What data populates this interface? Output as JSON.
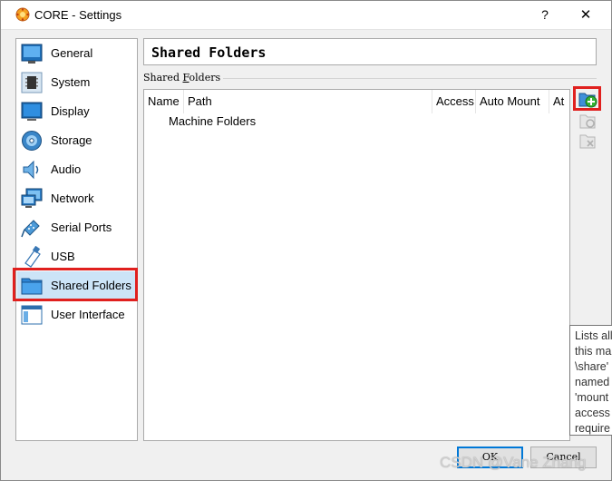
{
  "window": {
    "title": "CORE - Settings",
    "help_label": "?",
    "close_label": "✕"
  },
  "nav": {
    "items": [
      {
        "label": "General",
        "icon": "general-icon"
      },
      {
        "label": "System",
        "icon": "chip-icon"
      },
      {
        "label": "Display",
        "icon": "monitor-icon"
      },
      {
        "label": "Storage",
        "icon": "disk-icon"
      },
      {
        "label": "Audio",
        "icon": "speaker-icon"
      },
      {
        "label": "Network",
        "icon": "network-icon"
      },
      {
        "label": "Serial Ports",
        "icon": "serial-port-icon"
      },
      {
        "label": "USB",
        "icon": "usb-icon"
      },
      {
        "label": "Shared Folders",
        "icon": "folder-icon",
        "selected": true
      },
      {
        "label": "User Interface",
        "icon": "user-interface-icon"
      }
    ]
  },
  "page": {
    "title": "Shared Folders",
    "group_label_prefix": "Shared ",
    "group_label_mnemonic": "F",
    "group_label_suffix": "olders"
  },
  "table": {
    "columns": [
      "Name",
      "Path",
      "Access",
      "Auto Mount",
      "At"
    ],
    "rows": [
      {
        "name": "Machine Folders"
      }
    ]
  },
  "tooltip": {
    "lines": [
      "Lists all",
      "this ma",
      "\\share'",
      "named",
      "'mount",
      "access",
      "require"
    ]
  },
  "buttons": {
    "ok_label": "OK",
    "cancel_label": "Cancel"
  },
  "watermark": "CSDN @Vane Zhang",
  "colors": {
    "highlight_frame": "#e0201e",
    "selected_bg": "#cce4f7",
    "ok_border": "#0078d7"
  }
}
